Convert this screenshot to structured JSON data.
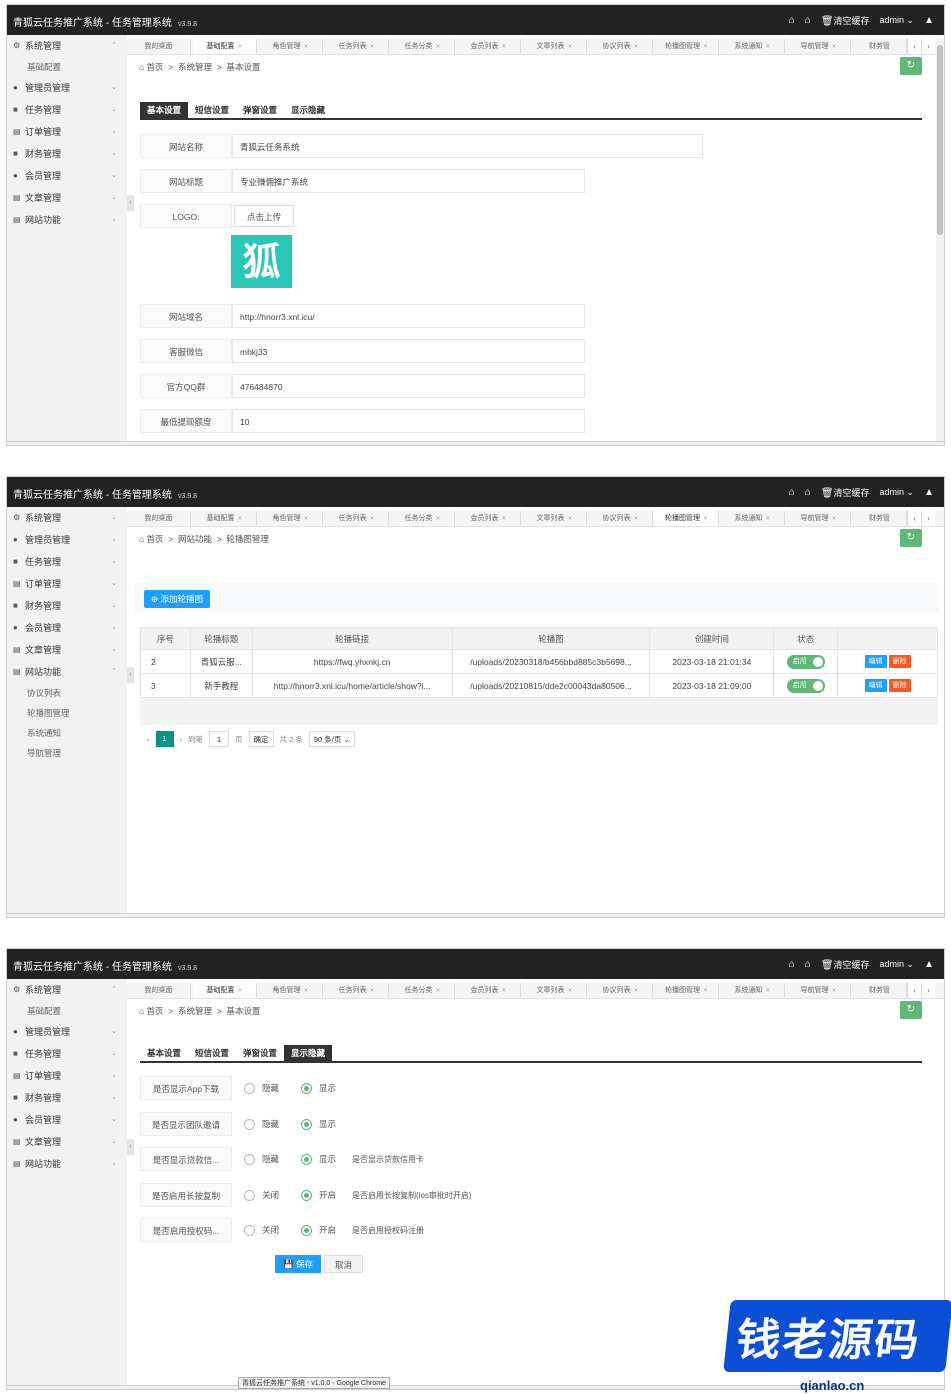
{
  "app": {
    "title": "青狐云任务推广系统 - 任务管理系统",
    "version": "v3.9.8",
    "clear_cache": "清空缓存",
    "user": "admin"
  },
  "tabs": [
    "我的桌面",
    "基础配置",
    "角色管理",
    "任务列表",
    "任务分类",
    "会员列表",
    "文章列表",
    "协议列表",
    "轮播图管理",
    "系统通知",
    "导航管理",
    "财务管"
  ],
  "sidebar": {
    "items": [
      "系统管理",
      "管理员管理",
      "任务管理",
      "订单管理",
      "财务管理",
      "会员管理",
      "文章管理",
      "网站功能"
    ],
    "sub_basic": "基础配置",
    "sub_site": [
      "协议列表",
      "轮播图管理",
      "系统通知",
      "导航管理"
    ]
  },
  "crumbs": {
    "home": "首页",
    "sys": "系统管理",
    "basic": "基本设置",
    "site": "网站功能",
    "carousel": "轮播图管理"
  },
  "form_tabs": [
    "基本设置",
    "短信设置",
    "弹窗设置",
    "显示隐藏"
  ],
  "basic_form": {
    "site_name_label": "网站名称",
    "site_name": "青狐云任务系统",
    "site_title_label": "网站标题",
    "site_title": "专业赚佣推广系统",
    "logo_label": "LOGO:",
    "upload": "点击上传",
    "logo_glyph": "狐",
    "domain_label": "网站域名",
    "domain": "http://hnorr3.xnl.icu/",
    "wechat_label": "客服微信",
    "wechat": "mhkj33",
    "qq_label": "官方QQ群",
    "qq": "476484870",
    "min_withdraw_label": "最低提现额度",
    "min_withdraw": "10"
  },
  "carousel": {
    "add_button": "添加轮播图",
    "columns": [
      "序号",
      "轮播标题",
      "轮播链接",
      "轮播图",
      "创建时间",
      "状态",
      ""
    ],
    "rows": [
      {
        "id": "2",
        "title": "青狐云服...",
        "link": "https://fwq.yhxnkj.cn",
        "image": "/uploads/20230318/b456bbd885c3b5698...",
        "time": "2023-03-18 21:01:34",
        "status": "启用"
      },
      {
        "id": "3",
        "title": "新手教程",
        "link": "http://hnorr3.xnl.icu/home/article/show?i...",
        "image": "/uploads/20210815/dde2c00043da80506...",
        "time": "2023-03-18 21:09:00",
        "status": "启用"
      }
    ],
    "edit": "编辑",
    "del": "删除",
    "pager": {
      "page": "1",
      "goto": "到第",
      "page_input": "1",
      "page_unit": "页",
      "confirm": "确定",
      "total": "共 2 条",
      "size": "90 条/页"
    }
  },
  "display_form": {
    "rows": [
      {
        "label": "是否显示App下载",
        "off": "隐藏",
        "on": "显示",
        "hint": ""
      },
      {
        "label": "是否显示团队邀请",
        "off": "隐藏",
        "on": "显示",
        "hint": ""
      },
      {
        "label": "是否显示贷款信...",
        "off": "隐藏",
        "on": "显示",
        "hint": "是否显示贷款信用卡"
      },
      {
        "label": "是否启用长按复制",
        "off": "关闭",
        "on": "开启",
        "hint": "是否启用长按复制(ios审批时开启)"
      },
      {
        "label": "是否启用授权码...",
        "off": "关闭",
        "on": "开启",
        "hint": "是否启用授权码注册"
      }
    ],
    "save": "保存",
    "cancel": "取消"
  },
  "tooltip": "青狐云任务推广系统 - v1.0.0 - Google Chrome",
  "watermark": {
    "text": "钱老源码",
    "url": "qianlao.cn"
  }
}
